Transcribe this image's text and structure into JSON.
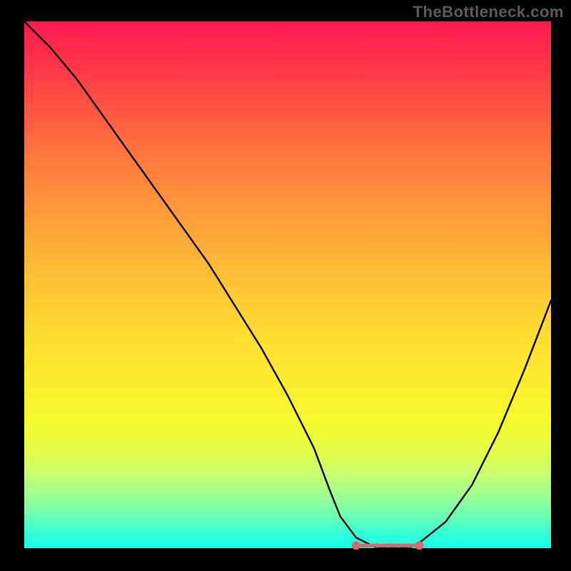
{
  "watermark": "TheBottleneck.com",
  "chart_data": {
    "type": "line",
    "title": "",
    "xlabel": "",
    "ylabel": "",
    "xlim": [
      0,
      100
    ],
    "ylim": [
      0,
      100
    ],
    "x": [
      0,
      5,
      10,
      15,
      20,
      25,
      30,
      35,
      40,
      45,
      50,
      55,
      58,
      60,
      63,
      67,
      70,
      73,
      75,
      80,
      85,
      90,
      95,
      100
    ],
    "values": [
      100,
      95,
      89,
      82,
      75,
      68,
      61,
      54,
      46,
      38,
      29,
      19,
      11,
      6,
      2,
      0,
      0,
      0,
      1,
      5,
      12,
      22,
      34,
      47
    ],
    "trough_region": {
      "x_start": 63,
      "x_end": 75,
      "y_approx": 0.5,
      "marker_color": "#d46a6a",
      "description": "highlighted flat minimum segment with dotted coral markers"
    },
    "gradient_meaning": "background hue runs from red (top, high bottleneck) through orange/yellow to green/teal (bottom, low bottleneck)"
  }
}
